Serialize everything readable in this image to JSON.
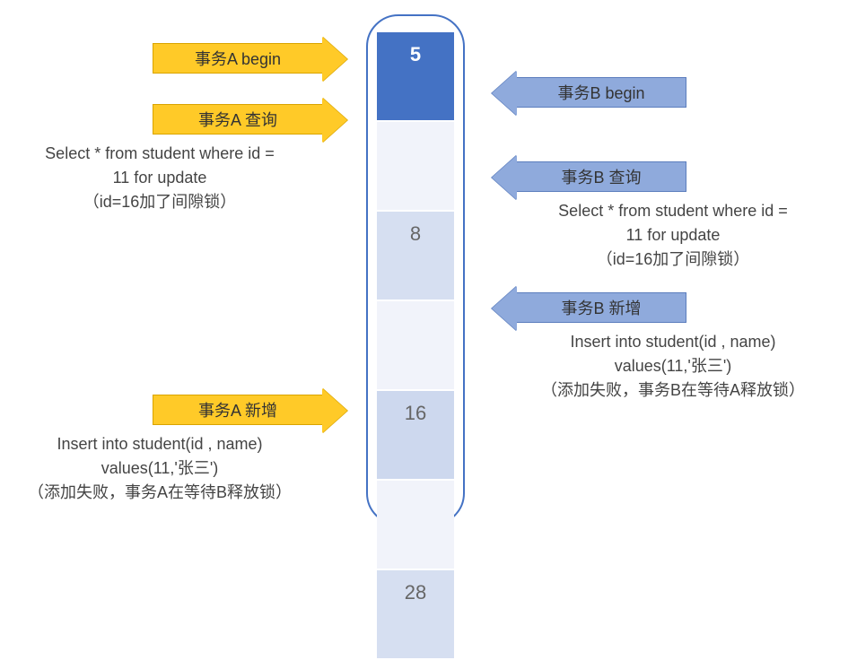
{
  "cells": {
    "v0": "5",
    "v1": "8",
    "v2": "16",
    "v3": "28"
  },
  "A": {
    "begin": "事务A begin",
    "query": "事务A 查询",
    "query_sql_1": "Select * from student where id =",
    "query_sql_2": "11 for update",
    "query_note": "（id=16加了间隙锁）",
    "insert": "事务A 新增",
    "insert_sql_1": "Insert into student(id , name)",
    "insert_sql_2": "values(11,'张三')",
    "insert_note": "（添加失败，事务A在等待B释放锁）"
  },
  "B": {
    "begin": "事务B begin",
    "query": "事务B 查询",
    "query_sql_1": "Select * from student where id =",
    "query_sql_2": "11 for update",
    "query_note": "（id=16加了间隙锁）",
    "insert": "事务B 新增",
    "insert_sql_1": "Insert into student(id , name)",
    "insert_sql_2": "values(11,'张三')",
    "insert_note": "（添加失败，事务B在等待A释放锁）"
  }
}
